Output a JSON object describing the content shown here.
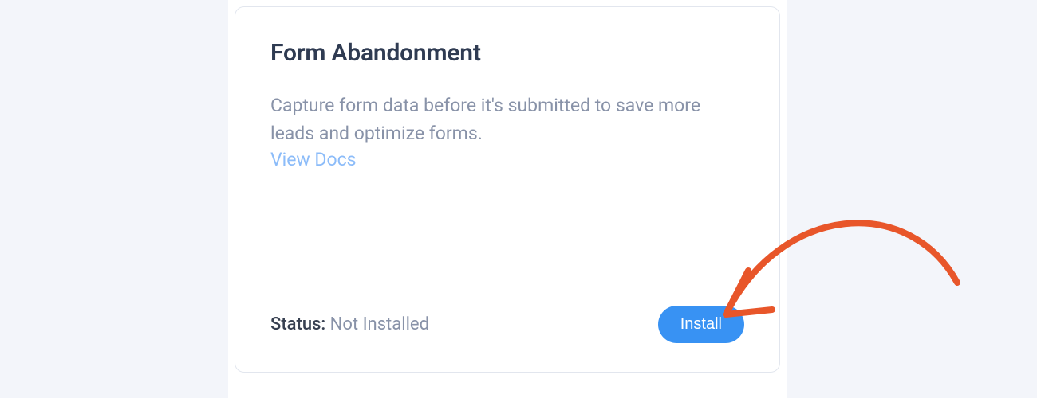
{
  "card": {
    "title": "Form Abandonment",
    "description": "Capture form data before it's submitted to save more leads and optimize forms.",
    "docs_link_label": "View Docs",
    "status_label": "Status:",
    "status_value": "Not Installed",
    "install_button_label": "Install"
  },
  "annotation": {
    "arrow_color": "#e8562a"
  }
}
